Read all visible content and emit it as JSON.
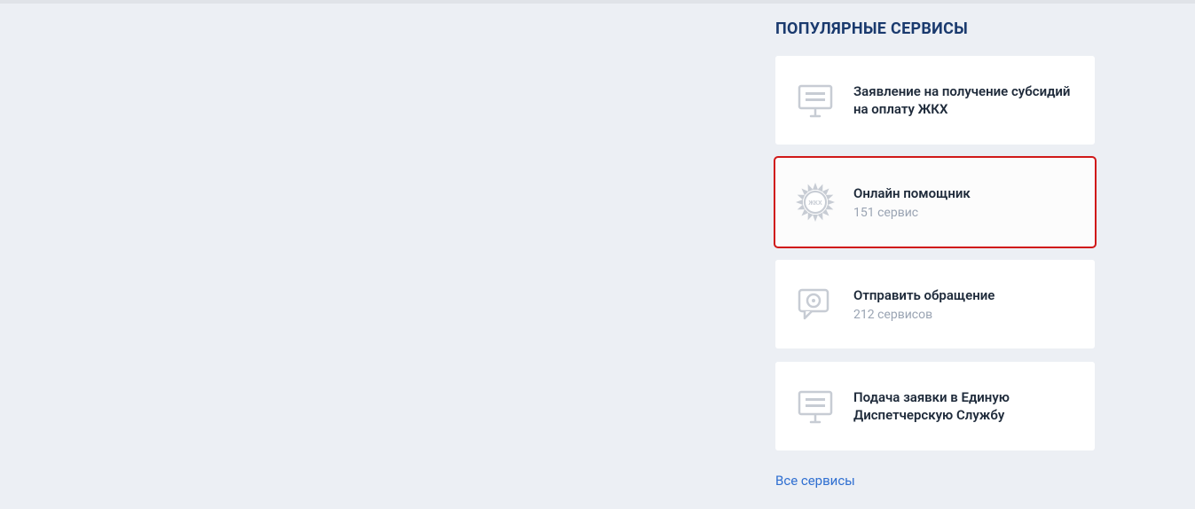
{
  "sidebar": {
    "title": "ПОПУЛЯРНЫЕ СЕРВИСЫ",
    "services": [
      {
        "title": "Заявление на получение субсидий на оплату ЖКХ",
        "subtitle": "",
        "icon": "monitor",
        "highlighted": false
      },
      {
        "title": "Онлайн помощник",
        "subtitle": "151 сервис",
        "icon": "gear",
        "highlighted": true
      },
      {
        "title": "Отправить обращение",
        "subtitle": "212 сервисов",
        "icon": "chat",
        "highlighted": false
      },
      {
        "title": "Подача заявки в Единую Диспетчерскую Службу",
        "subtitle": "",
        "icon": "monitor",
        "highlighted": false
      }
    ],
    "all_services_link": "Все сервисы"
  }
}
